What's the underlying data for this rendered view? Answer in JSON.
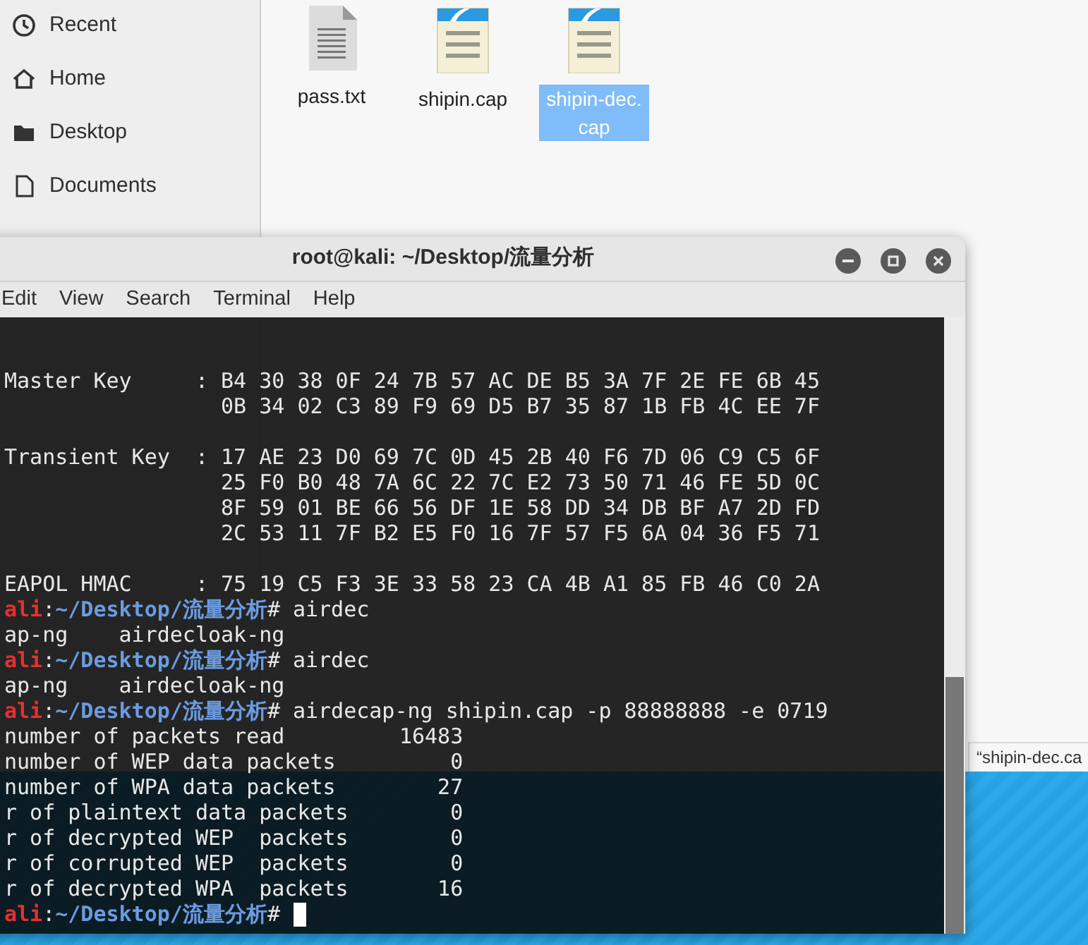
{
  "file_manager": {
    "sidebar": [
      {
        "label": "Recent",
        "kind": "clock"
      },
      {
        "label": "Home",
        "kind": "home"
      },
      {
        "label": "Desktop",
        "kind": "folder"
      },
      {
        "label": "Documents",
        "kind": "document"
      }
    ],
    "files": [
      {
        "name": "pass.txt",
        "kind": "text",
        "selected": false
      },
      {
        "name": "shipin.cap",
        "kind": "capture",
        "selected": false
      },
      {
        "name": "shipin-dec.cap",
        "kind": "capture",
        "selected": true
      }
    ],
    "status_label": "“shipin-dec.ca"
  },
  "terminal": {
    "title": "root@kali: ~/Desktop/流量分析",
    "menu": [
      "Edit",
      "View",
      "Search",
      "Terminal",
      "Help"
    ],
    "lines": [
      {
        "kind": "text",
        "text": "Master Key     : B4 30 38 0F 24 7B 57 AC DE B5 3A 7F 2E FE 6B 45"
      },
      {
        "kind": "text",
        "text": "                 0B 34 02 C3 89 F9 69 D5 B7 35 87 1B FB 4C EE 7F"
      },
      {
        "kind": "blank"
      },
      {
        "kind": "text",
        "text": "Transient Key  : 17 AE 23 D0 69 7C 0D 45 2B 40 F6 7D 06 C9 C5 6F"
      },
      {
        "kind": "text",
        "text": "                 25 F0 B0 48 7A 6C 22 7C E2 73 50 71 46 FE 5D 0C"
      },
      {
        "kind": "text",
        "text": "                 8F 59 01 BE 66 56 DF 1E 58 DD 34 DB BF A7 2D FD"
      },
      {
        "kind": "text",
        "text": "                 2C 53 11 7F B2 E5 F0 16 7F 57 F5 6A 04 36 F5 71"
      },
      {
        "kind": "blank"
      },
      {
        "kind": "text",
        "text": "EAPOL HMAC     : 75 19 C5 F3 3E 33 58 23 CA 4B A1 85 FB 46 C0 2A"
      },
      {
        "kind": "prompt",
        "user": "ali",
        "separator": ":",
        "path": "~/Desktop/流量分析",
        "symbol": "#",
        "command": "airdec",
        "cursor": false
      },
      {
        "kind": "text",
        "text": "ap-ng    airdecloak-ng"
      },
      {
        "kind": "prompt",
        "user": "ali",
        "separator": ":",
        "path": "~/Desktop/流量分析",
        "symbol": "#",
        "command": "airdec",
        "cursor": false
      },
      {
        "kind": "text",
        "text": "ap-ng    airdecloak-ng"
      },
      {
        "kind": "prompt",
        "user": "ali",
        "separator": ":",
        "path": "~/Desktop/流量分析",
        "symbol": "#",
        "command": "airdecap-ng shipin.cap -p 88888888 -e 0719",
        "cursor": false
      },
      {
        "kind": "text",
        "text": "number of packets read         16483"
      },
      {
        "kind": "text",
        "text": "number of WEP data packets         0"
      },
      {
        "kind": "text",
        "text": "number of WPA data packets        27"
      },
      {
        "kind": "text",
        "text": "r of plaintext data packets        0"
      },
      {
        "kind": "text",
        "text": "r of decrypted WEP  packets        0"
      },
      {
        "kind": "text",
        "text": "r of corrupted WEP  packets        0"
      },
      {
        "kind": "text",
        "text": "r of decrypted WPA  packets       16"
      },
      {
        "kind": "prompt",
        "user": "ali",
        "separator": ":",
        "path": "~/Desktop/流量分析",
        "symbol": "#",
        "cursor": true
      }
    ]
  }
}
